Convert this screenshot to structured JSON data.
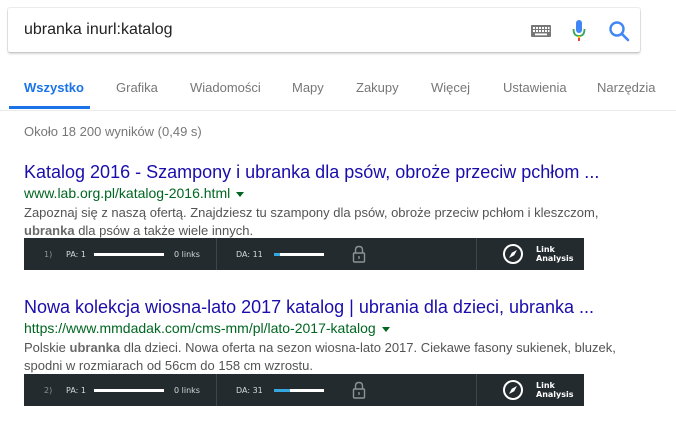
{
  "search": {
    "query": "ubranka inurl:katalog",
    "icons": [
      "keyboard-icon",
      "microphone-icon",
      "search-icon"
    ]
  },
  "tabs": [
    {
      "label": "Wszystko",
      "active": true
    },
    {
      "label": "Grafika",
      "active": false
    },
    {
      "label": "Wiadomości",
      "active": false
    },
    {
      "label": "Mapy",
      "active": false
    },
    {
      "label": "Zakupy",
      "active": false
    },
    {
      "label": "Więcej",
      "active": false
    },
    {
      "label": "Ustawienia",
      "active": false
    },
    {
      "label": "Narzędzia",
      "active": false
    }
  ],
  "stats": "Około 18 200 wyników (0,49 s)",
  "results": [
    {
      "title": "Katalog 2016 - Szampony i ubranka dla psów, obroże przeciw pchłom ...",
      "url": "www.lab.org.pl/katalog-2016.html",
      "snippet_1": "Zapoznaj się z naszą ofertą. Znajdziesz tu szampony dla psów, obroże przeciw pchłom i kleszczom,",
      "snippet_2_bold": "ubranka",
      "snippet_2_rest": " dla psów a także wiele innych.",
      "mozbar": {
        "index": "1)",
        "pa": "PA: 1",
        "links": "0 links",
        "da": "DA: 11",
        "da_value": 11,
        "pa_value": 1
      }
    },
    {
      "title": "Nowa kolekcja wiosna-lato 2017 katalog | ubrania dla dzieci, ubranka ...",
      "url": "https://www.mmdadak.com/cms-mm/pl/lato-2017-katalog",
      "snippet_1_pre": "Polskie ",
      "snippet_1_bold": "ubranka",
      "snippet_1_rest": " dla dzieci. Nowa oferta na sezon wiosna-lato 2017. Ciekawe fasony sukienek, bluzek,",
      "snippet_2": "spodni w rozmiarach od 56cm do 158 cm wzrostu.",
      "mozbar": {
        "index": "2)",
        "pa": "PA: 1",
        "links": "0 links",
        "da": "DA: 31",
        "da_value": 31,
        "pa_value": 1
      }
    }
  ],
  "mozbar_label": {
    "line1": "Link",
    "line2": "Analysis"
  },
  "colors": {
    "accent": "#1a73e8",
    "link_title": "#1a0dab",
    "url_green": "#006621",
    "mozbar_bg": "#232b2e",
    "da_fill": "#37a7e0"
  }
}
